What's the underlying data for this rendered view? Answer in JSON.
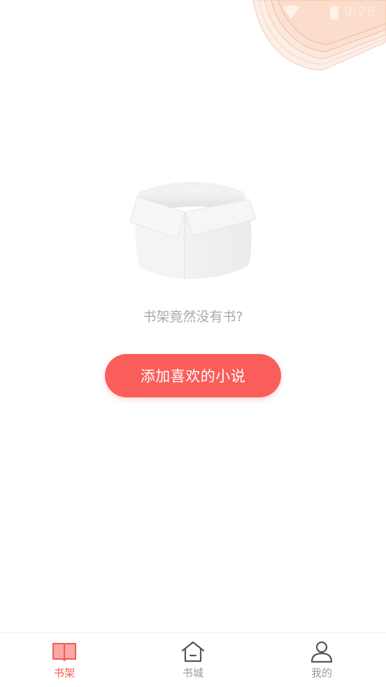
{
  "status_bar": {
    "time": "9:26",
    "icons": [
      "wifi-icon",
      "battery-icon"
    ]
  },
  "empty_state": {
    "illustration": "empty-box-illustration",
    "message": "书架竟然没有书?",
    "add_button_label": "添加喜欢的小说"
  },
  "tab_bar": {
    "items": [
      {
        "label": "书架",
        "icon": "open-book-icon",
        "active": true
      },
      {
        "label": "书城",
        "icon": "home-icon",
        "active": false
      },
      {
        "label": "我的",
        "icon": "user-icon",
        "active": false
      }
    ]
  },
  "colors": {
    "accent": "#fa5e5a",
    "tab_active": "#f25a56",
    "tab_inactive": "#9a9a9a",
    "message_text": "#a9a9a9"
  }
}
